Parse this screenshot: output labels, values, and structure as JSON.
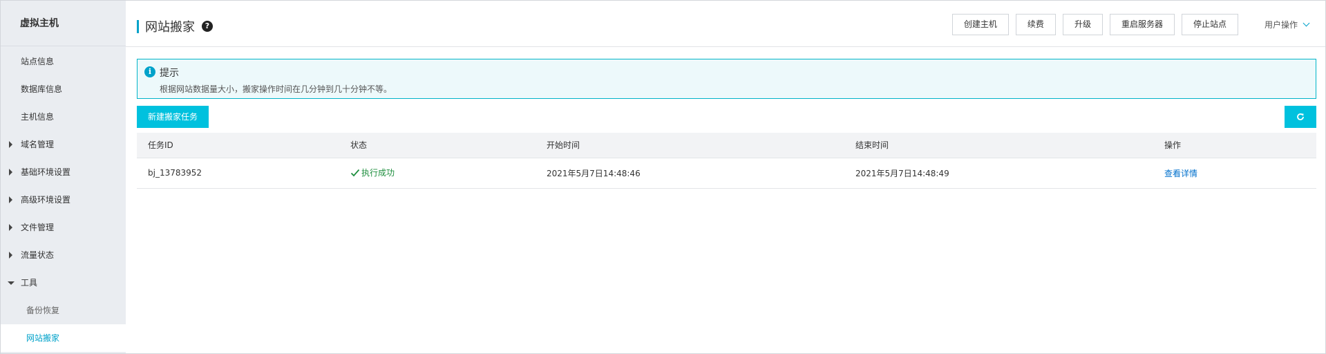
{
  "sidebar": {
    "title": "虚拟主机",
    "items": [
      {
        "label": "站点信息",
        "type": "leaf"
      },
      {
        "label": "数据库信息",
        "type": "leaf"
      },
      {
        "label": "主机信息",
        "type": "leaf"
      },
      {
        "label": "域名管理",
        "type": "collapsed"
      },
      {
        "label": "基础环境设置",
        "type": "collapsed"
      },
      {
        "label": "高级环境设置",
        "type": "collapsed"
      },
      {
        "label": "文件管理",
        "type": "collapsed"
      },
      {
        "label": "流量状态",
        "type": "collapsed"
      },
      {
        "label": "工具",
        "type": "expanded"
      },
      {
        "label": "备份恢复",
        "type": "sub"
      },
      {
        "label": "网站搬家",
        "type": "sub-active"
      }
    ]
  },
  "header": {
    "title": "网站搬家",
    "help_glyph": "?",
    "buttons": [
      "创建主机",
      "续费",
      "升级",
      "重启服务器",
      "停止站点"
    ],
    "user_ops": "用户操作"
  },
  "notice": {
    "title": "提示",
    "text": "根据网站数据量大小，搬家操作时间在几分钟到几十分钟不等。"
  },
  "actions": {
    "new_task": "新建搬家任务"
  },
  "table": {
    "columns": [
      "任务ID",
      "状态",
      "开始时间",
      "结束时间",
      "操作"
    ],
    "rows": [
      {
        "id": "bj_13783952",
        "status": "执行成功",
        "start": "2021年5月7日14:48:46",
        "end": "2021年5月7日14:48:49",
        "action": "查看详情"
      }
    ]
  },
  "colors": {
    "accent": "#00c1de",
    "link": "#0070cc",
    "success": "#1e8e3e"
  }
}
